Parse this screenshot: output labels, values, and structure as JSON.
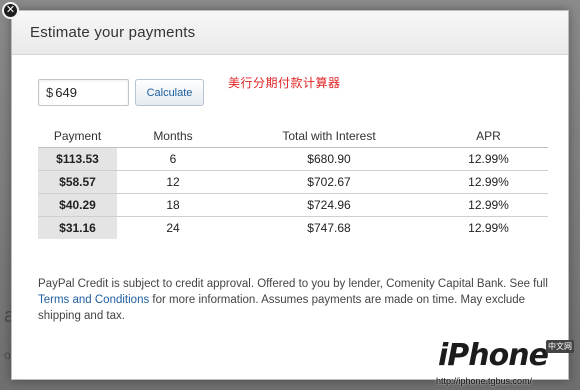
{
  "backdrop": {
    "fragment_1": "at",
    "fragment_2": "o"
  },
  "modal": {
    "title": "Estimate your payments",
    "close_icon": "close-icon"
  },
  "calculator": {
    "currency_symbol": "$",
    "amount_value": "649",
    "calculate_label": "Calculate"
  },
  "annotation": "美行分期付款计算器",
  "table": {
    "headers": [
      "Payment",
      "Months",
      "Total with Interest",
      "APR"
    ],
    "rows": [
      {
        "payment": "$113.53",
        "months": "6",
        "total": "$680.90",
        "apr": "12.99%"
      },
      {
        "payment": "$58.57",
        "months": "12",
        "total": "$702.67",
        "apr": "12.99%"
      },
      {
        "payment": "$40.29",
        "months": "18",
        "total": "$724.96",
        "apr": "12.99%"
      },
      {
        "payment": "$31.16",
        "months": "24",
        "total": "$747.68",
        "apr": "12.99%"
      }
    ]
  },
  "footnote": {
    "part1": "PayPal Credit is subject to credit approval. Offered to you by lender, Comenity Capital Bank. See full ",
    "link": "Terms and Conditions",
    "part2": " for more information. Assumes payments are made on time. May exclude shipping and tax."
  },
  "watermark": {
    "logo_text": "iPhone",
    "badge_text": "中文网",
    "url_text": "http://iphone.tgbus.com/"
  },
  "colors": {
    "link": "#1f5fa0",
    "annotation": "#e02424",
    "highlight_cell": "#e4e4e4"
  }
}
